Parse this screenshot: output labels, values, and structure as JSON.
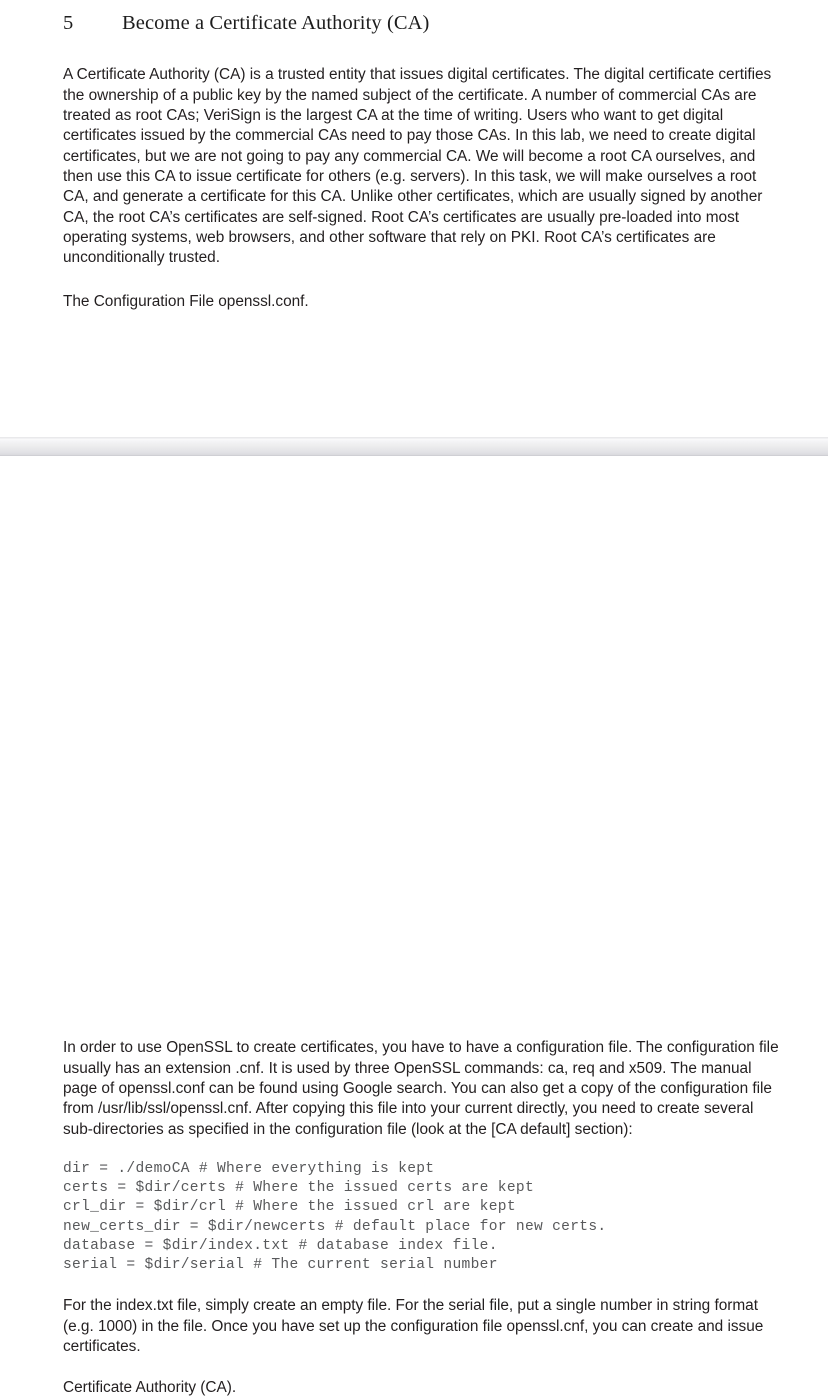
{
  "document": {
    "section_number": "5",
    "section_title": "Become a Certificate Authority (CA)",
    "paragraphs": {
      "intro": "A Certificate Authority (CA) is a trusted entity that issues digital certificates. The digital certificate certifies the ownership of a public key by the named subject of the certificate. A number of commercial CAs are treated as root CAs; VeriSign is the largest CA at the time of writing. Users who want to get digital certificates issued by the commercial CAs need to pay those CAs. In this lab, we need to create digital certificates, but we are not going to pay any commercial CA. We will become a root CA ourselves, and then use this CA to issue certificate for others (e.g. servers). In this task, we will make ourselves a root CA, and generate a certificate for this CA. Unlike other certificates, which are usually signed by another CA, the root CA’s certificates are self-signed. Root CA’s certificates are usually pre-loaded into most operating systems, web browsers, and other software that rely on PKI. Root CA’s certificates are unconditionally trusted.",
      "config_file": "The Configuration File openssl.conf.",
      "openssl_config": "In order to use OpenSSL to create certificates, you have to have a configuration file. The configuration file usually has an extension .cnf. It is used by three OpenSSL commands: ca, req and x509. The manual page of openssl.conf can be found using Google search. You can also get a copy of the configuration file from /usr/lib/ssl/openssl.cnf. After copying this file into your current directly, you need to create several sub-directories as specified in the configuration file (look at the [CA default] section):",
      "index_file": "For the index.txt file, simply create an empty file. For the serial file, put a single number in string format (e.g. 1000) in the file. Once you have set up the configuration file openssl.cnf, you can create and issue certificates.",
      "certificate_authority": "Certificate Authority (CA)."
    },
    "code_block": "dir = ./demoCA # Where everything is kept\ncerts = $dir/certs # Where the issued certs are kept\ncrl_dir = $dir/crl # Where the issued crl are kept\nnew_certs_dir = $dir/newcerts # default place for new certs.\ndatabase = $dir/index.txt # database index file.\nserial = $dir/serial # The current serial number"
  }
}
